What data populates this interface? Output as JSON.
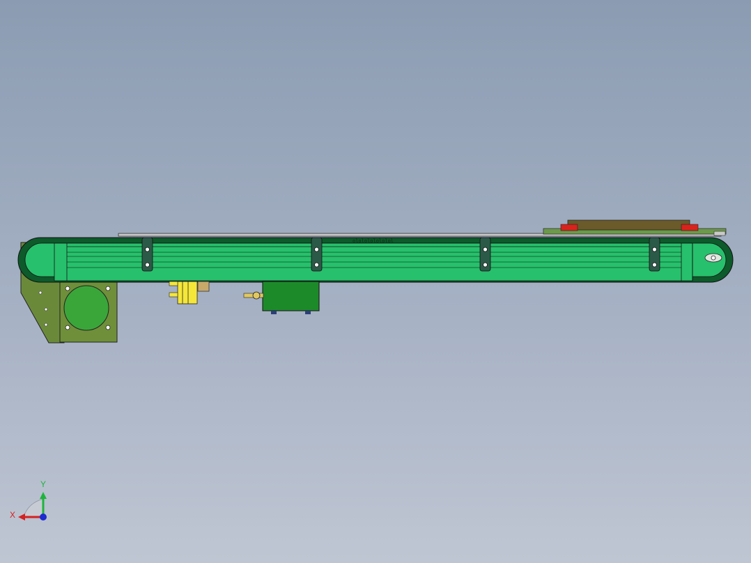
{
  "viewport": {
    "background_top": "#8b9cb2",
    "background_bottom": "#bfc6d3"
  },
  "colors": {
    "belt": "#27c06c",
    "belt_dark": "#0d5a2a",
    "frame_olive": "#6a8a3a",
    "motor_green": "#3aa63a",
    "gearbox": "#1d8a2a",
    "sensor_yellow": "#f5e63a",
    "pad_red": "#d8231c",
    "plate_brown": "#6b5a2a",
    "axis_x": "#d42020",
    "axis_y": "#1eb43c",
    "axis_z": "#1c2ccf"
  },
  "model": {
    "name": "belt-conveyor-assembly",
    "bracket_count": 4,
    "markings": "ololololololol"
  },
  "triad": {
    "x_label": "X",
    "y_label": "Y",
    "icon": "coordinate-triad-icon"
  }
}
